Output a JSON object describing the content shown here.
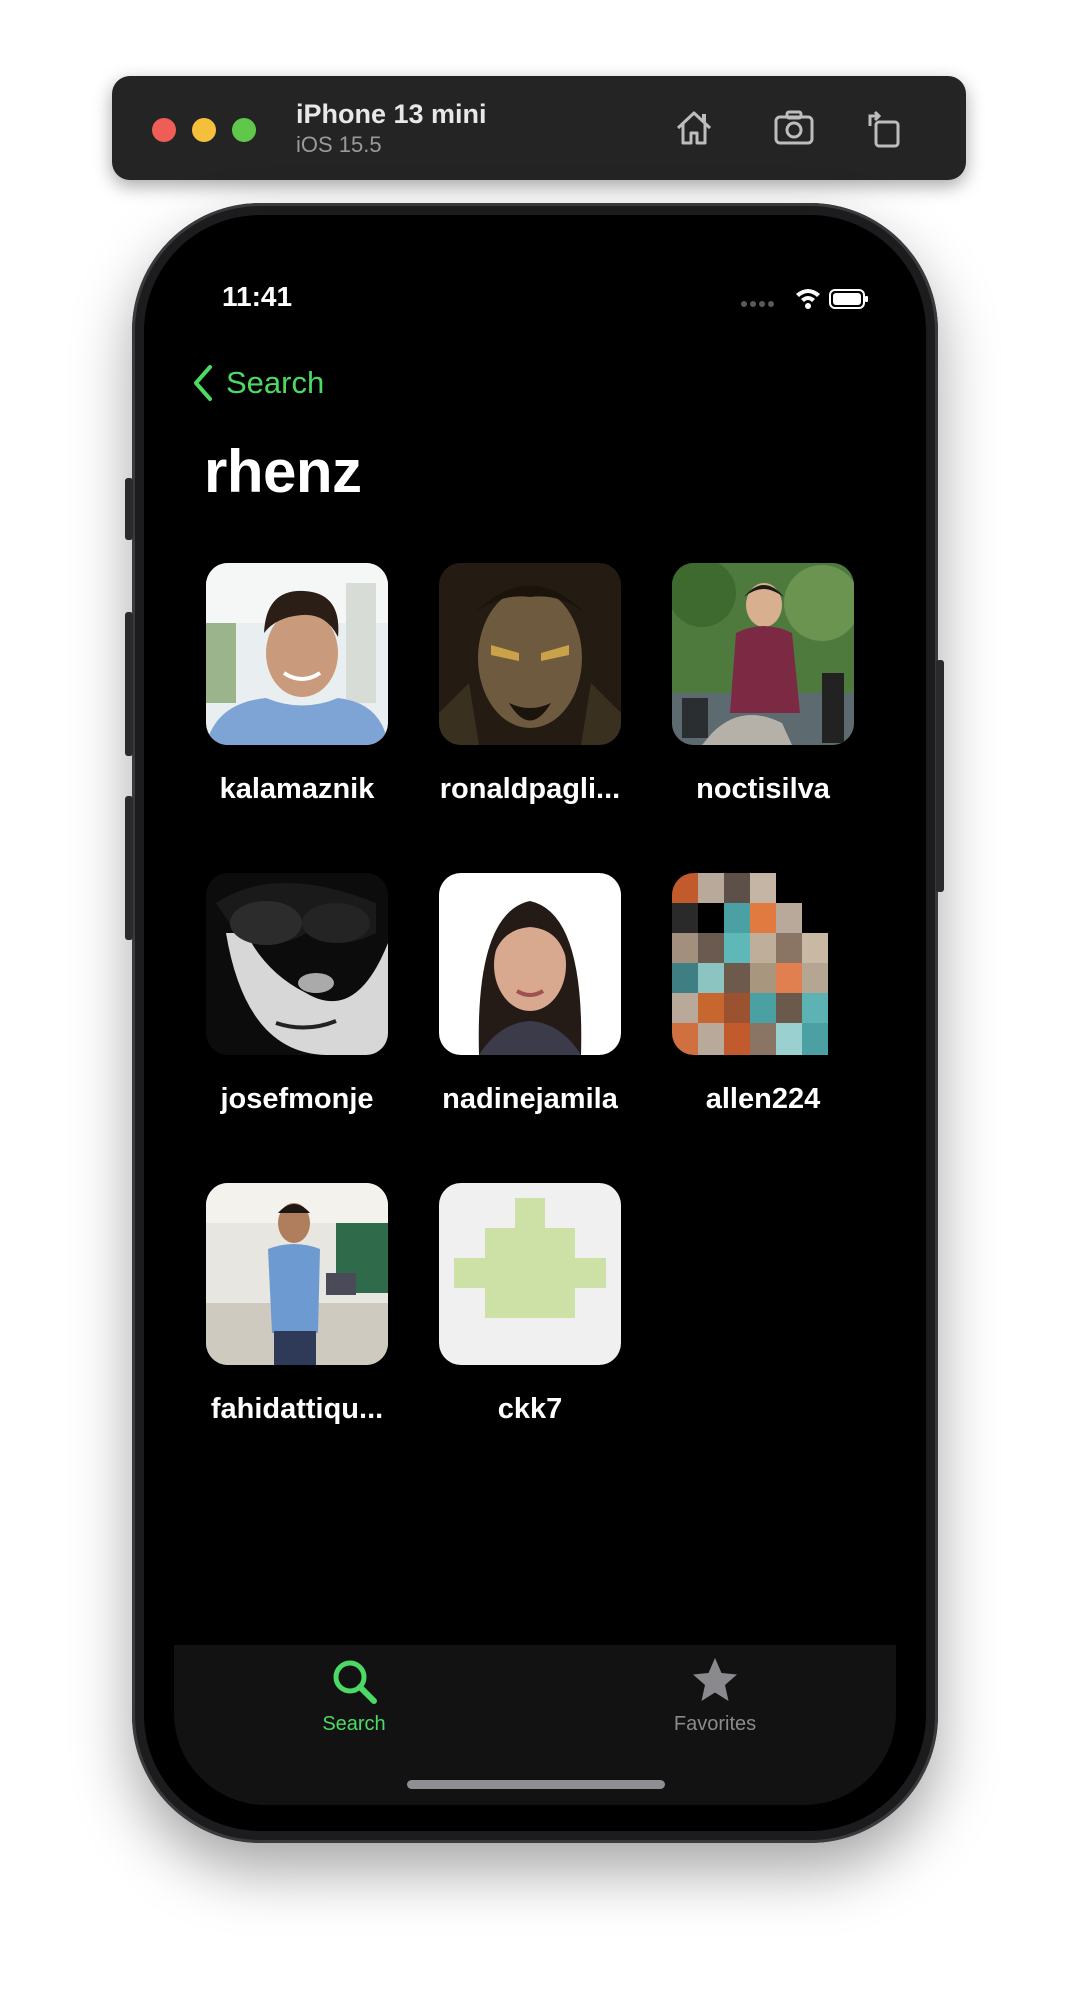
{
  "simulator": {
    "device_name": "iPhone 13 mini",
    "os_version": "iOS 15.5",
    "window_controls": [
      "close",
      "minimize",
      "zoom"
    ],
    "toolbar_icons": [
      "home-icon",
      "screenshot-icon",
      "rotate-icon"
    ]
  },
  "status_bar": {
    "time": "11:41",
    "icons": [
      "signal-icon",
      "wifi-icon",
      "battery-icon"
    ]
  },
  "nav": {
    "back_label": "Search",
    "title": "rhenz"
  },
  "users": [
    {
      "username": "kalamaznik"
    },
    {
      "username": "ronaldpagli..."
    },
    {
      "username": "noctisilva"
    },
    {
      "username": "josefmonje"
    },
    {
      "username": "nadinejamila"
    },
    {
      "username": "allen224"
    },
    {
      "username": "fahidattiqu..."
    },
    {
      "username": "ckk7"
    }
  ],
  "tab_bar": {
    "tabs": [
      {
        "label": "Search",
        "icon": "search-icon",
        "selected": true
      },
      {
        "label": "Favorites",
        "icon": "star-icon",
        "selected": false
      }
    ]
  },
  "colors": {
    "accent": "#4cd964",
    "background": "#000000",
    "tab_bar": "#121212",
    "inactive_tab": "#8a8a8e"
  }
}
